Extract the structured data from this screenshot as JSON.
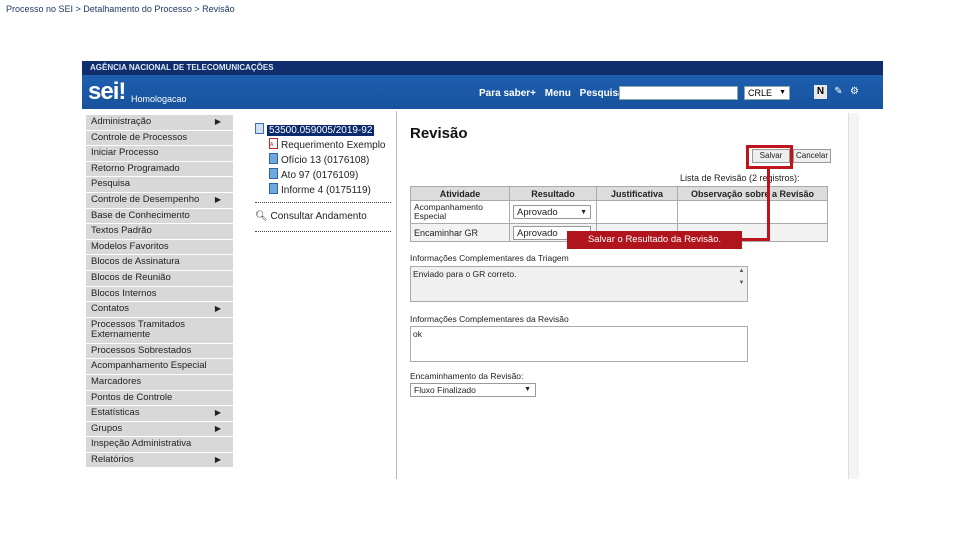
{
  "breadcrumb": "Processo no SEI > Detalhamento do Processo > Revisão",
  "header": {
    "agency": "AGÊNCIA NACIONAL DE TELECOMUNICAÇÕES",
    "logo": "sei!",
    "environment": "Homologacao",
    "nav_links": [
      "Para saber+",
      "Menu",
      "Pesquisa"
    ],
    "unit_select": "CRLE",
    "toolbar_icons": [
      "new-document-icon",
      "tools-icon",
      "settings-icon"
    ]
  },
  "sidebar": {
    "items": [
      {
        "label": "Administração",
        "submenu": true
      },
      {
        "label": "Controle de Processos",
        "submenu": false
      },
      {
        "label": "Iniciar Processo",
        "submenu": false
      },
      {
        "label": "Retorno Programado",
        "submenu": false
      },
      {
        "label": "Pesquisa",
        "submenu": false
      },
      {
        "label": "Controle de Desempenho",
        "submenu": true
      },
      {
        "label": "Base de Conhecimento",
        "submenu": false
      },
      {
        "label": "Textos Padrão",
        "submenu": false
      },
      {
        "label": "Modelos Favoritos",
        "submenu": false
      },
      {
        "label": "Blocos de Assinatura",
        "submenu": false
      },
      {
        "label": "Blocos de Reunião",
        "submenu": false
      },
      {
        "label": "Blocos Internos",
        "submenu": false
      },
      {
        "label": "Contatos",
        "submenu": true
      },
      {
        "label": "Processos Tramitados Externamente",
        "submenu": false,
        "tall": true
      },
      {
        "label": "Processos Sobrestados",
        "submenu": false
      },
      {
        "label": "Acompanhamento Especial",
        "submenu": false
      },
      {
        "label": "Marcadores",
        "submenu": false
      },
      {
        "label": "Pontos de Controle",
        "submenu": false
      },
      {
        "label": "Estatísticas",
        "submenu": true
      },
      {
        "label": "Grupos",
        "submenu": true
      },
      {
        "label": "Inspeção Administrativa",
        "submenu": false
      },
      {
        "label": "Relatórios",
        "submenu": true
      }
    ]
  },
  "tree": {
    "process_number": "53500.059005/2019-92",
    "documents": [
      {
        "label": "Requerimento Exemplo",
        "icon": "pdf-icon"
      },
      {
        "label": "Ofício 13 (0176108)",
        "icon": "document-icon"
      },
      {
        "label": "Ato 97 (0176109)",
        "icon": "document-icon"
      },
      {
        "label": "Informe 4 (0175119)",
        "icon": "document-icon"
      }
    ],
    "consult_link": "Consultar Andamento"
  },
  "review": {
    "title": "Revisão",
    "save_button": "Salvar",
    "cancel_button": "Cancelar",
    "list_caption": "Lista de Revisão (2 registros):",
    "columns": [
      "Atividade",
      "Resultado",
      "Justificativa",
      "Observação sobre a Revisão"
    ],
    "rows": [
      {
        "activity": "Acompanhamento Especial",
        "result": "Aprovado"
      },
      {
        "activity": "Encaminhar GR",
        "result": "Aprovado"
      }
    ],
    "triage_label": "Informações Complementares da Triagem",
    "triage_text": "Enviado para o GR correto.",
    "review_info_label": "Informações Complementares da Revisão",
    "review_info_text": "ok",
    "forwarding_label": "Encaminhamento da Revisão:",
    "forwarding_value": "Fluxo Finalizado"
  },
  "annotation": {
    "callout": "Salvar o Resultado da Revisão.",
    "color": "#c0141c"
  }
}
